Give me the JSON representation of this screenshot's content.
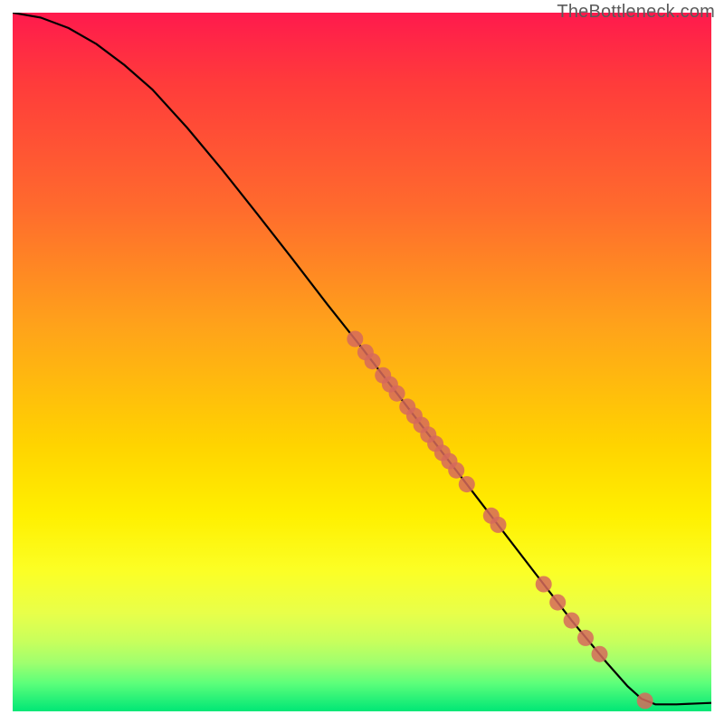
{
  "watermark": "TheBottleneck.com",
  "chart_data": {
    "type": "line",
    "title": "",
    "xlabel": "",
    "ylabel": "",
    "xlim": [
      0,
      100
    ],
    "ylim": [
      0,
      100
    ],
    "curve": {
      "name": "decay-curve",
      "points": [
        {
          "x": 0,
          "y": 100
        },
        {
          "x": 4,
          "y": 99.3
        },
        {
          "x": 8,
          "y": 97.8
        },
        {
          "x": 12,
          "y": 95.5
        },
        {
          "x": 16,
          "y": 92.5
        },
        {
          "x": 20,
          "y": 89.0
        },
        {
          "x": 25,
          "y": 83.5
        },
        {
          "x": 30,
          "y": 77.5
        },
        {
          "x": 35,
          "y": 71.2
        },
        {
          "x": 40,
          "y": 64.8
        },
        {
          "x": 45,
          "y": 58.3
        },
        {
          "x": 50,
          "y": 52.0
        },
        {
          "x": 55,
          "y": 45.5
        },
        {
          "x": 60,
          "y": 39.0
        },
        {
          "x": 65,
          "y": 32.5
        },
        {
          "x": 70,
          "y": 26.0
        },
        {
          "x": 75,
          "y": 19.5
        },
        {
          "x": 80,
          "y": 13.0
        },
        {
          "x": 85,
          "y": 7.0
        },
        {
          "x": 88,
          "y": 3.6
        },
        {
          "x": 90,
          "y": 1.8
        },
        {
          "x": 92,
          "y": 1.0
        },
        {
          "x": 95,
          "y": 1.0
        },
        {
          "x": 100,
          "y": 1.2
        }
      ]
    },
    "scatter": {
      "name": "marker-points",
      "color": "#d66a5c",
      "points": [
        {
          "x": 49.0,
          "y": 53.3
        },
        {
          "x": 50.5,
          "y": 51.4
        },
        {
          "x": 51.5,
          "y": 50.1
        },
        {
          "x": 53.0,
          "y": 48.1
        },
        {
          "x": 54.0,
          "y": 46.8
        },
        {
          "x": 55.0,
          "y": 45.5
        },
        {
          "x": 56.5,
          "y": 43.6
        },
        {
          "x": 57.5,
          "y": 42.3
        },
        {
          "x": 58.5,
          "y": 41.0
        },
        {
          "x": 59.5,
          "y": 39.6
        },
        {
          "x": 60.5,
          "y": 38.3
        },
        {
          "x": 61.5,
          "y": 37.0
        },
        {
          "x": 62.5,
          "y": 35.8
        },
        {
          "x": 63.5,
          "y": 34.5
        },
        {
          "x": 65.0,
          "y": 32.5
        },
        {
          "x": 68.5,
          "y": 28.0
        },
        {
          "x": 69.5,
          "y": 26.7
        },
        {
          "x": 76.0,
          "y": 18.2
        },
        {
          "x": 78.0,
          "y": 15.6
        },
        {
          "x": 80.0,
          "y": 13.0
        },
        {
          "x": 82.0,
          "y": 10.5
        },
        {
          "x": 84.0,
          "y": 8.2
        },
        {
          "x": 90.5,
          "y": 1.5
        }
      ]
    }
  }
}
